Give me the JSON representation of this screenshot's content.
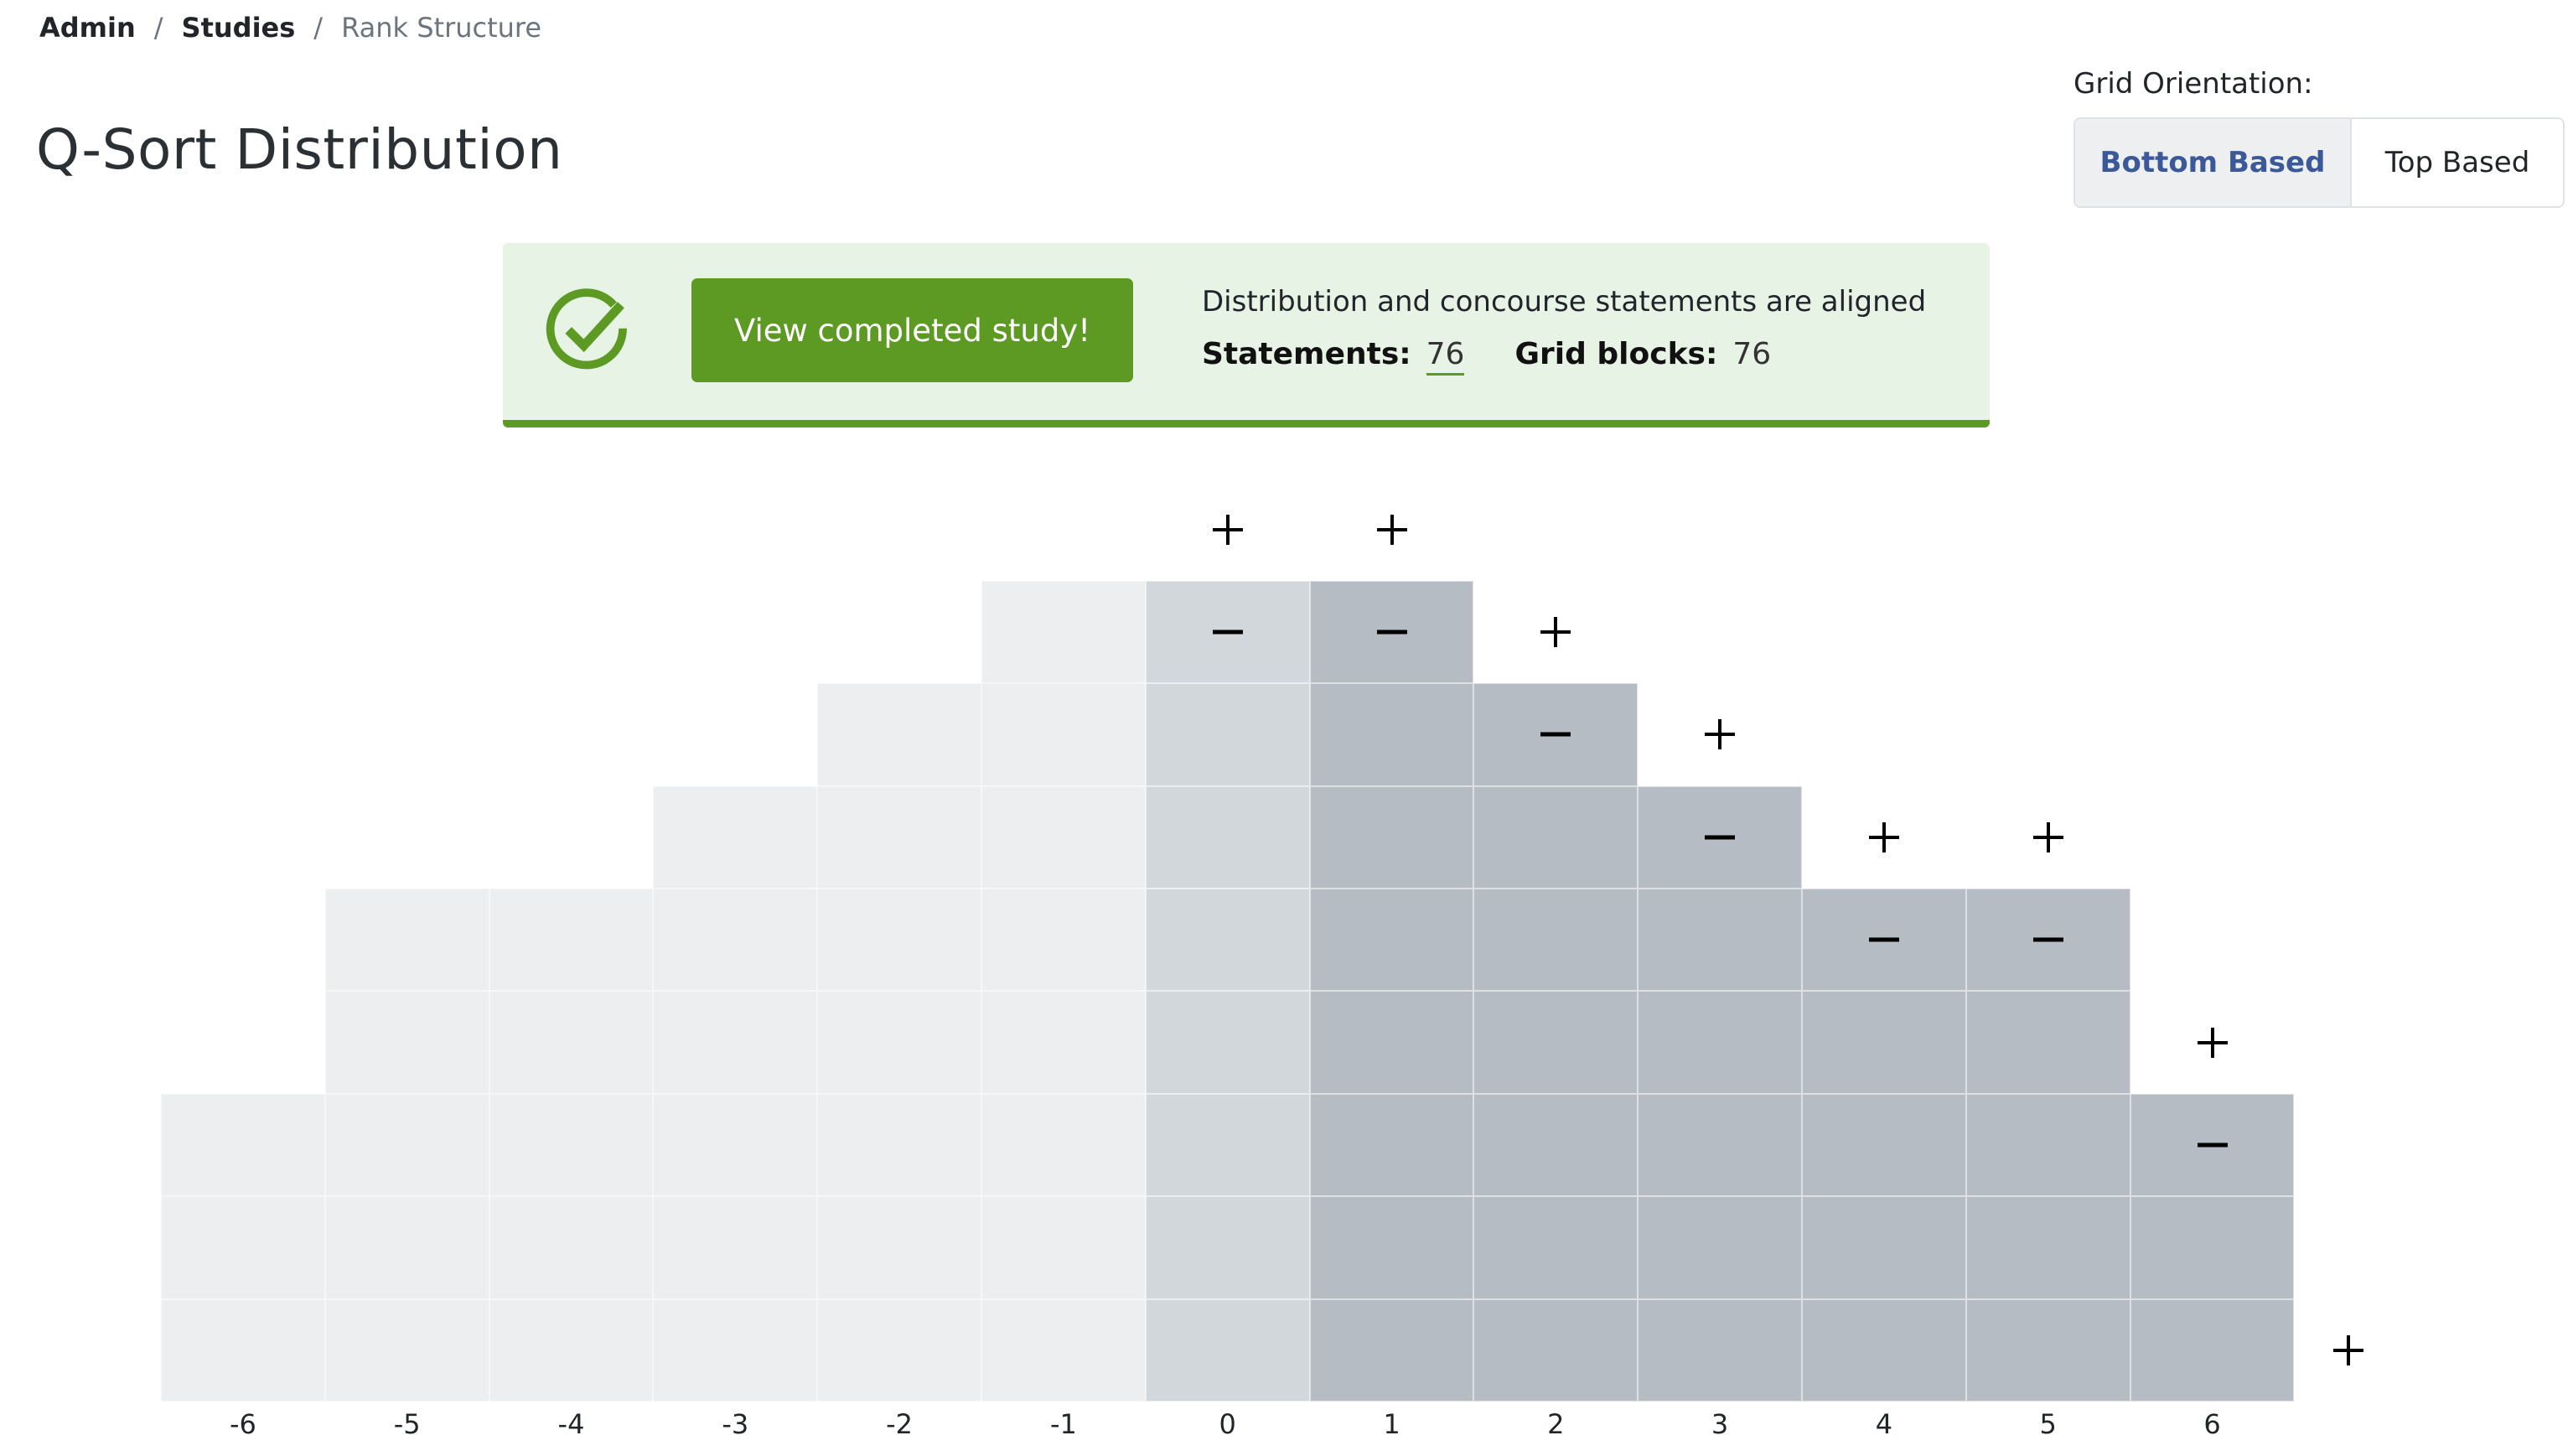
{
  "breadcrumb": {
    "items": [
      {
        "label": "Admin"
      },
      {
        "label": "Studies"
      },
      {
        "label": "Rank Structure"
      }
    ],
    "separator": "/"
  },
  "page": {
    "title": "Q-Sort Distribution"
  },
  "orientation": {
    "label": "Grid Orientation:",
    "options": [
      {
        "label": "Bottom Based",
        "selected": true
      },
      {
        "label": "Top Based",
        "selected": false
      }
    ]
  },
  "banner": {
    "icon": "check-circle-icon",
    "button_label": "View completed study!",
    "message": "Distribution and concourse statements are aligned",
    "statements_label": "Statements:",
    "statements_value": "76",
    "grid_blocks_label": "Grid blocks:",
    "grid_blocks_value": "76",
    "accent_color": "#5c9a23",
    "background_color": "#e7f3e4"
  },
  "grid": {
    "colors": {
      "negative": "#edeef0",
      "zero": "#d2d7db",
      "positive": "#b5bcc4"
    },
    "columns": [
      {
        "label": "-6",
        "value": -6,
        "count": 3,
        "controls": false
      },
      {
        "label": "-5",
        "value": -5,
        "count": 5,
        "controls": false
      },
      {
        "label": "-4",
        "value": -4,
        "count": 5,
        "controls": false
      },
      {
        "label": "-3",
        "value": -3,
        "count": 6,
        "controls": false
      },
      {
        "label": "-2",
        "value": -2,
        "count": 7,
        "controls": false
      },
      {
        "label": "-1",
        "value": -1,
        "count": 8,
        "controls": false
      },
      {
        "label": "0",
        "value": 0,
        "count": 8,
        "controls": true
      },
      {
        "label": "1",
        "value": 1,
        "count": 8,
        "controls": true
      },
      {
        "label": "2",
        "value": 2,
        "count": 7,
        "controls": true
      },
      {
        "label": "3",
        "value": 3,
        "count": 6,
        "controls": true
      },
      {
        "label": "4",
        "value": 4,
        "count": 5,
        "controls": true
      },
      {
        "label": "5",
        "value": 5,
        "count": 5,
        "controls": true
      },
      {
        "label": "6",
        "value": 6,
        "count": 3,
        "controls": true
      }
    ],
    "add_column_icon": "plus-icon",
    "increment_icon": "plus-icon",
    "decrement_icon": "minus-icon"
  }
}
